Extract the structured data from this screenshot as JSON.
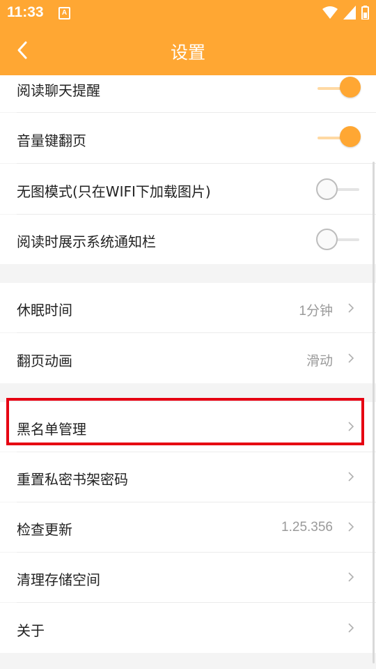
{
  "status_bar": {
    "time": "11:33",
    "notification_badge": "A"
  },
  "app_bar": {
    "title": "设置"
  },
  "toggles": [
    {
      "label": "阅读聊天提醒",
      "on": true
    },
    {
      "label": "音量键翻页",
      "on": true
    },
    {
      "label": "无图模式(只在WIFI下加载图片)",
      "on": false
    },
    {
      "label": "阅读时展示系统通知栏",
      "on": false
    }
  ],
  "reading": [
    {
      "label": "休眠时间",
      "value": "1分钟"
    },
    {
      "label": "翻页动画",
      "value": "滑动"
    }
  ],
  "other": [
    {
      "label": "黑名单管理",
      "value": ""
    },
    {
      "label": "重置私密书架密码",
      "value": ""
    },
    {
      "label": "检查更新",
      "value": "1.25.356"
    },
    {
      "label": "清理存储空间",
      "value": ""
    },
    {
      "label": "关于",
      "value": ""
    }
  ],
  "colors": {
    "accent": "#ffa733",
    "highlight": "#e60012"
  }
}
